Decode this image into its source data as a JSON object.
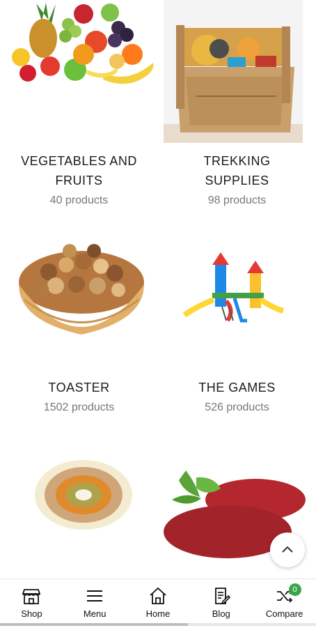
{
  "categories": [
    {
      "title_line1": "VEGETABLES AND",
      "title_line2": "FRUITS",
      "count": "40 products"
    },
    {
      "title_line1": "TREKKING",
      "title_line2": "SUPPLIES",
      "count": "98 products"
    },
    {
      "title_line1": "TOASTER",
      "title_line2": "",
      "count": "1502 products"
    },
    {
      "title_line1": "THE GAMES",
      "title_line2": "",
      "count": "526 products"
    },
    {
      "title_line1": "",
      "title_line2": "",
      "count": ""
    },
    {
      "title_line1": "",
      "title_line2": "",
      "count": ""
    }
  ],
  "nav": [
    {
      "label": "Shop",
      "icon": "shop-icon"
    },
    {
      "label": "Menu",
      "icon": "menu-icon"
    },
    {
      "label": "Home",
      "icon": "home-icon"
    },
    {
      "label": "Blog",
      "icon": "blog-icon"
    },
    {
      "label": "Compare",
      "icon": "compare-icon",
      "badge": "0"
    }
  ],
  "colors": {
    "badge": "#3aa64a"
  }
}
